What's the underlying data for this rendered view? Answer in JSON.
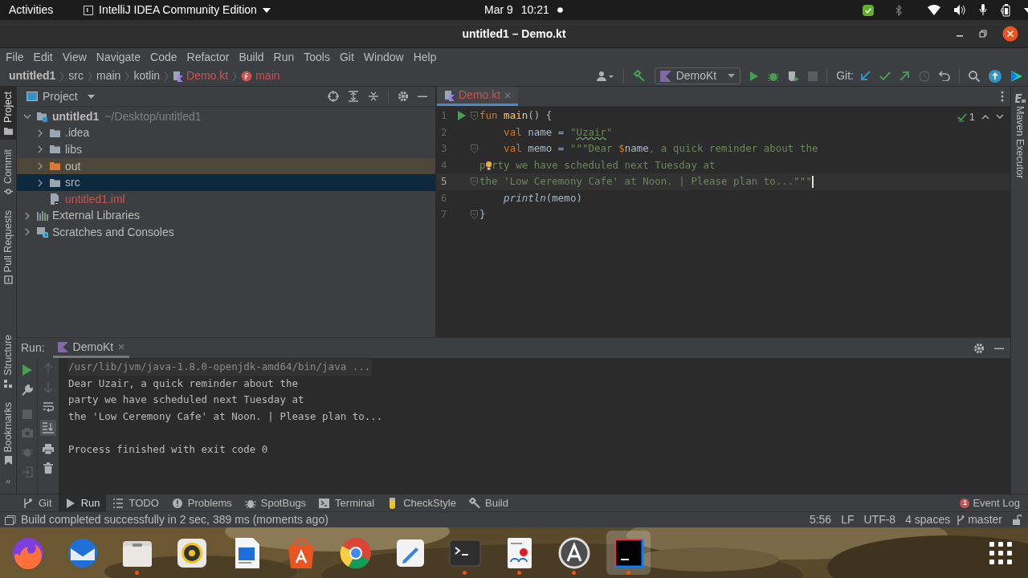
{
  "top_bar": {
    "activities": "Activities",
    "app_menu": "IntelliJ IDEA Community Edition",
    "date": "Mar 9",
    "time": "10:21"
  },
  "window": {
    "title": "untitled1 – Demo.kt"
  },
  "menu": [
    "File",
    "Edit",
    "View",
    "Navigate",
    "Code",
    "Refactor",
    "Build",
    "Run",
    "Tools",
    "Git",
    "Window",
    "Help"
  ],
  "breadcrumbs": [
    {
      "label": "untitled1",
      "kind": "project"
    },
    {
      "label": "src",
      "kind": "dir"
    },
    {
      "label": "main",
      "kind": "dir"
    },
    {
      "label": "kotlin",
      "kind": "dir"
    },
    {
      "label": "Demo.kt",
      "kind": "file"
    },
    {
      "label": "main",
      "kind": "function"
    }
  ],
  "toolbar": {
    "run_config": "DemoKt",
    "git_label": "Git:"
  },
  "left_strip": [
    {
      "label": "Project",
      "selected": true
    },
    {
      "label": "Commit",
      "selected": false
    },
    {
      "label": "Pull Requests",
      "selected": false
    }
  ],
  "left_strip_bottom": [
    {
      "label": "Structure",
      "selected": false
    },
    {
      "label": "Bookmarks",
      "selected": false
    }
  ],
  "left_strip_more": "»",
  "project_panel": {
    "title": "Project",
    "tree": [
      {
        "label": "untitled1",
        "path": "~/Desktop/untitled1",
        "kind": "module",
        "expanded": true,
        "selected": false,
        "children": [
          {
            "label": ".idea",
            "kind": "folder",
            "expanded": false,
            "selected": false
          },
          {
            "label": "libs",
            "kind": "folder",
            "expanded": false,
            "selected": false
          },
          {
            "label": "out",
            "kind": "excluded_folder",
            "expanded": false,
            "selected": false
          },
          {
            "label": "src",
            "kind": "folder",
            "expanded": false,
            "selected": true
          },
          {
            "label": "untitled1.iml",
            "kind": "unversioned_file",
            "selected": false
          }
        ]
      },
      {
        "label": "External Libraries",
        "kind": "libraries",
        "expanded": false,
        "selected": false
      },
      {
        "label": "Scratches and Consoles",
        "kind": "scratches",
        "expanded": false,
        "selected": false
      }
    ]
  },
  "editor": {
    "tabs": [
      {
        "label": "Demo.kt",
        "selected": true
      }
    ],
    "inspection_count": "1",
    "side_label": "Maven Executor",
    "lines": [
      {
        "number": "1",
        "current": false,
        "run_marker": true,
        "fold": true,
        "tokens": [
          {
            "text": "fun ",
            "kind": "kw"
          },
          {
            "text": "main",
            "kind": "fn"
          },
          {
            "text": "() {",
            "kind": "plain"
          }
        ]
      },
      {
        "number": "2",
        "current": false,
        "run_marker": false,
        "fold": false,
        "tokens": [
          {
            "text": "    val ",
            "kind": "kw"
          },
          {
            "text": "name = ",
            "kind": "plain"
          },
          {
            "text": "\"",
            "kind": "str"
          },
          {
            "text": "Uzair",
            "kind": "typo"
          },
          {
            "text": "\"",
            "kind": "str"
          }
        ]
      },
      {
        "number": "3",
        "current": false,
        "run_marker": false,
        "fold": true,
        "tokens": [
          {
            "text": "    val ",
            "kind": "kw"
          },
          {
            "text": "memo = ",
            "kind": "plain"
          },
          {
            "text": "\"\"\"Dear ",
            "kind": "str"
          },
          {
            "text": "$",
            "kind": "kw"
          },
          {
            "text": "name",
            "kind": "plain"
          },
          {
            "text": ", a quick reminder about the",
            "kind": "str"
          }
        ]
      },
      {
        "number": "4",
        "current": false,
        "run_marker": false,
        "fold": false,
        "tokens": [
          {
            "text": "p",
            "kind": "str"
          },
          {
            "kind": "bulb"
          },
          {
            "text": "rty we have scheduled next Tuesday at",
            "kind": "str"
          }
        ]
      },
      {
        "number": "5",
        "current": true,
        "run_marker": false,
        "fold": true,
        "tokens": [
          {
            "text": "the 'Low Ceremony Cafe' at Noon. | Please plan to...\"\"\"",
            "kind": "str"
          }
        ]
      },
      {
        "number": "6",
        "current": false,
        "run_marker": false,
        "fold": false,
        "tokens": [
          {
            "text": "    println",
            "kind": "call"
          },
          {
            "text": "(memo)",
            "kind": "plain"
          }
        ]
      },
      {
        "number": "7",
        "current": false,
        "run_marker": false,
        "fold": true,
        "tokens": [
          {
            "text": "}",
            "kind": "plain"
          }
        ]
      }
    ]
  },
  "run_panel": {
    "title": "Run:",
    "tabs": [
      {
        "label": "DemoKt",
        "selected": true
      }
    ],
    "console": [
      {
        "text": "/usr/lib/jvm/java-1.8.0-openjdk-amd64/bin/java ...",
        "kind": "command"
      },
      {
        "text": "Dear Uzair, a quick reminder about the",
        "kind": "output"
      },
      {
        "text": "party we have scheduled next Tuesday at",
        "kind": "output"
      },
      {
        "text": "the 'Low Ceremony Cafe' at Noon. | Please plan to...",
        "kind": "output"
      },
      {
        "kind": "blank"
      },
      {
        "text": "Process finished with exit code 0",
        "kind": "output"
      }
    ]
  },
  "tool_tabs": [
    {
      "label": "Git",
      "kind": "git",
      "selected": false
    },
    {
      "label": "Run",
      "kind": "run",
      "selected": true
    },
    {
      "label": "TODO",
      "kind": "todo",
      "selected": false
    },
    {
      "label": "Problems",
      "kind": "problems",
      "selected": false
    },
    {
      "label": "SpotBugs",
      "kind": "bugs",
      "selected": false
    },
    {
      "label": "Terminal",
      "kind": "terminal",
      "selected": false
    },
    {
      "label": "CheckStyle",
      "kind": "checkstyle",
      "selected": false
    },
    {
      "label": "Build",
      "kind": "build",
      "selected": false
    }
  ],
  "event_log": {
    "label": "Event Log",
    "badge": "1"
  },
  "status_bar": {
    "message": "Build completed successfully in 2 sec, 389 ms (moments ago)",
    "position": "5:56",
    "line_separator": "LF",
    "encoding": "UTF-8",
    "indent": "4 spaces",
    "branch": "master"
  },
  "dock": [
    {
      "kind": "fox",
      "running": false,
      "selected": false
    },
    {
      "kind": "mail",
      "running": false,
      "selected": false
    },
    {
      "kind": "files",
      "running": true,
      "selected": false
    },
    {
      "kind": "audio",
      "running": false,
      "selected": false
    },
    {
      "kind": "document",
      "running": false,
      "selected": false
    },
    {
      "kind": "store",
      "running": false,
      "selected": false
    },
    {
      "kind": "browser",
      "running": false,
      "selected": false
    },
    {
      "kind": "editor",
      "running": false,
      "selected": false
    },
    {
      "kind": "terminal",
      "running": true,
      "selected": false
    },
    {
      "kind": "viewer",
      "running": true,
      "selected": false
    },
    {
      "kind": "updater",
      "running": true,
      "selected": false
    },
    {
      "kind": "ide",
      "running": true,
      "selected": true
    }
  ]
}
